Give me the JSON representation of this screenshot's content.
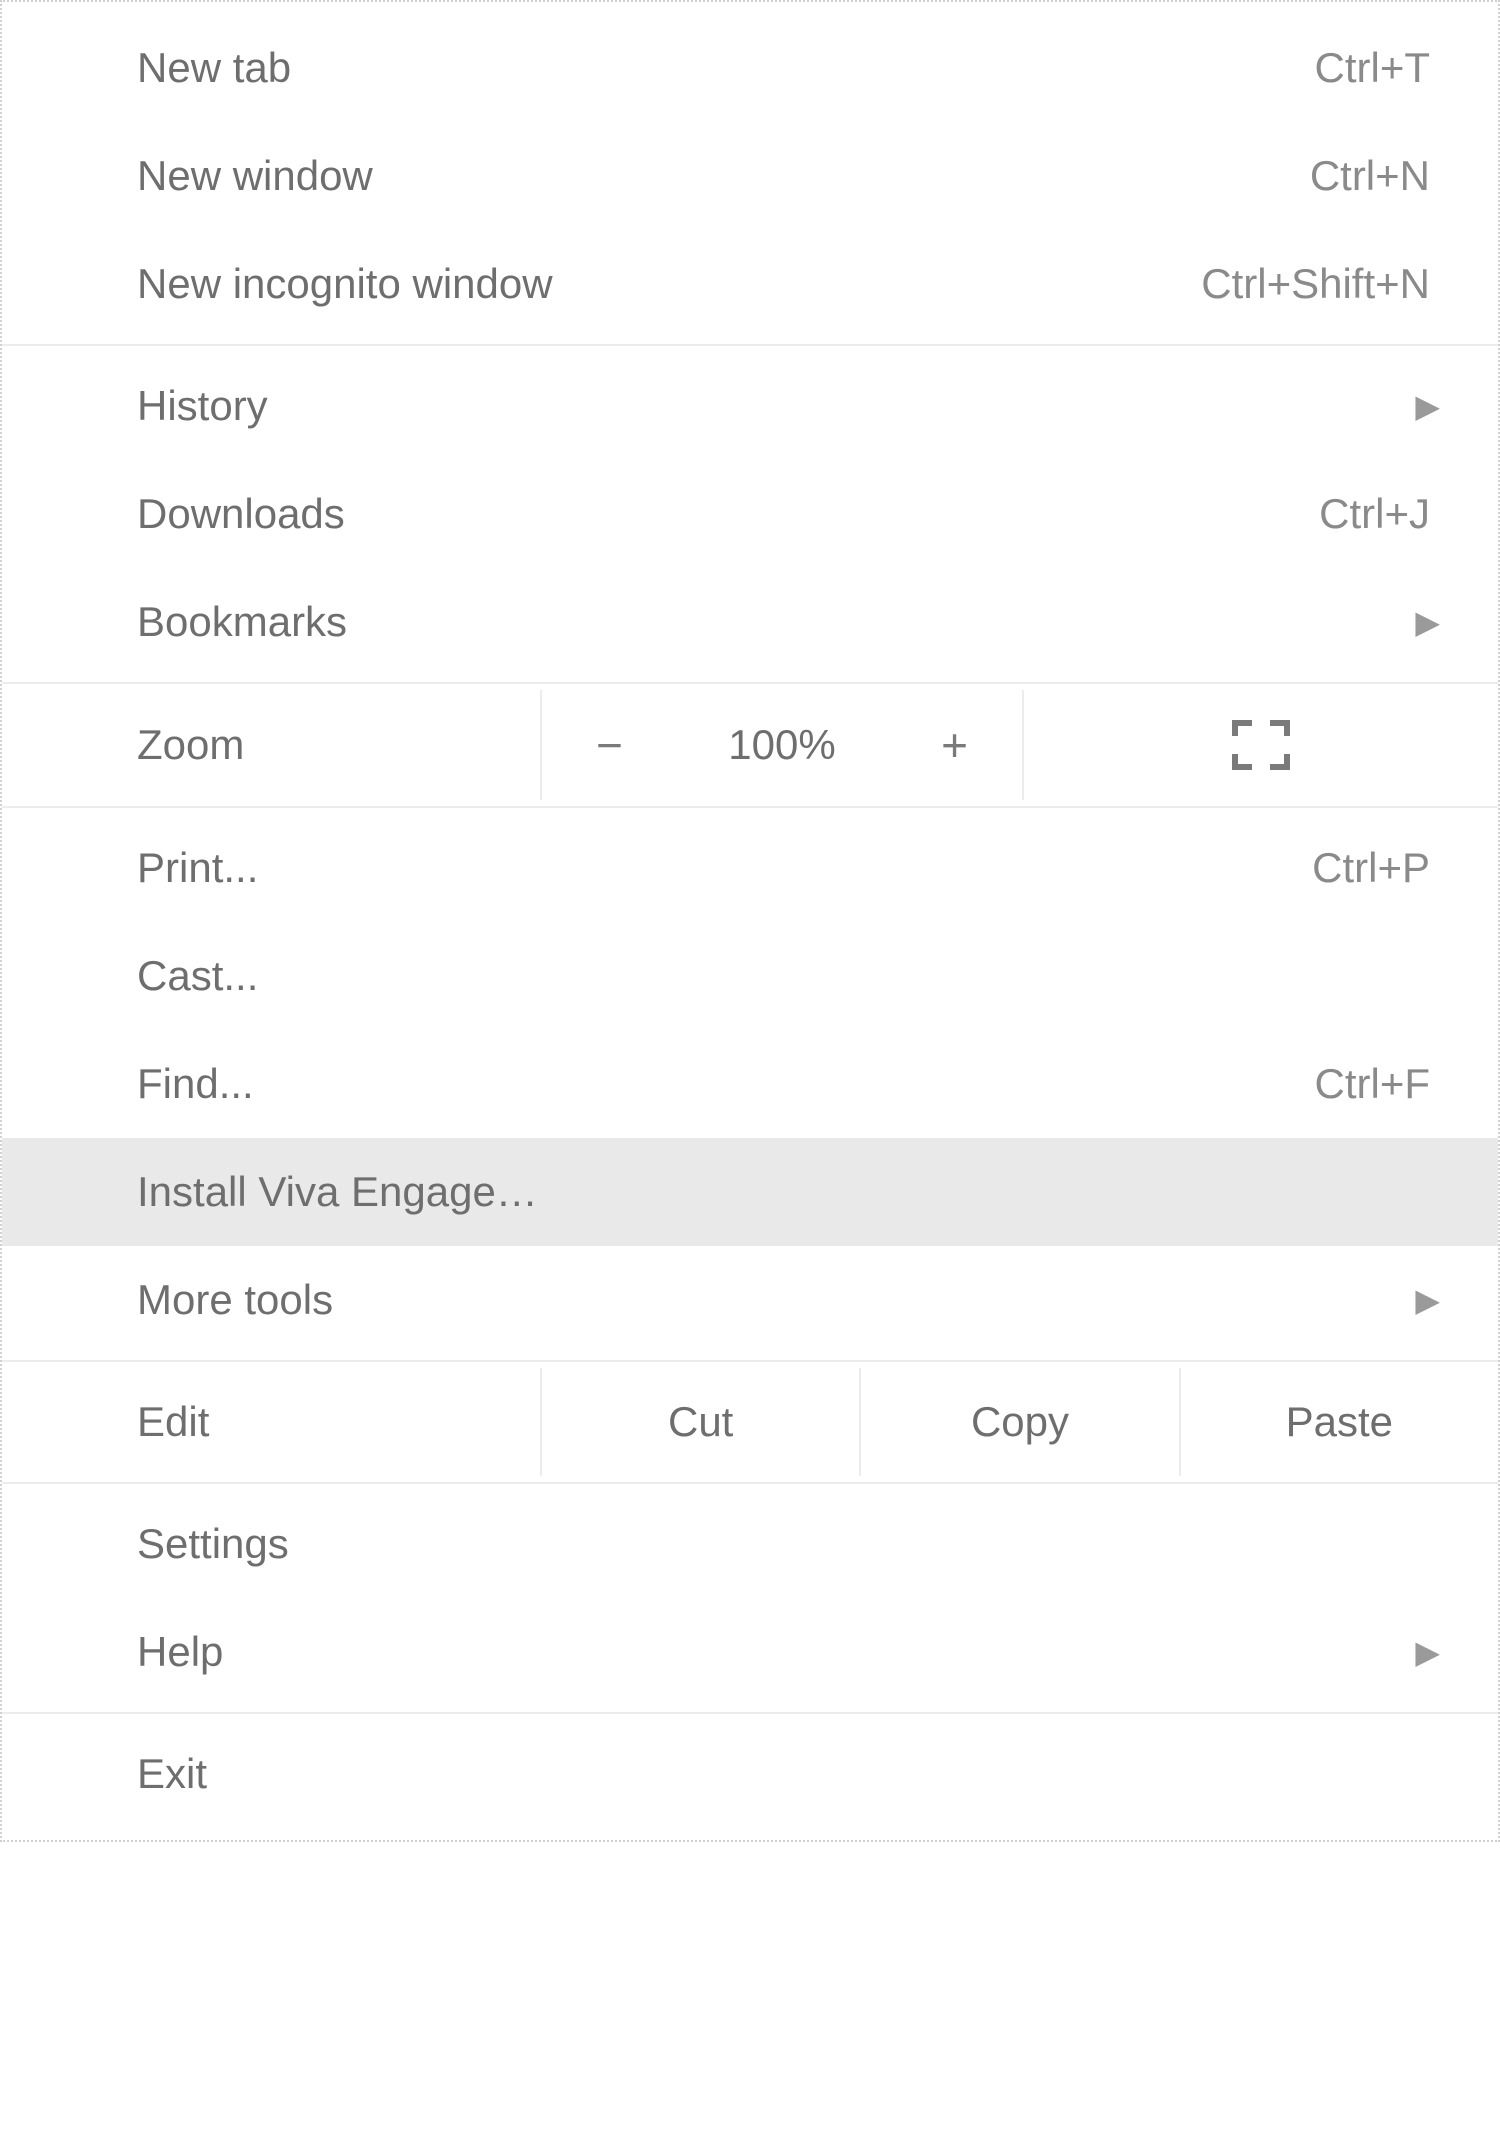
{
  "menu": {
    "section1": {
      "new_tab": {
        "label": "New tab",
        "shortcut": "Ctrl+T"
      },
      "new_window": {
        "label": "New window",
        "shortcut": "Ctrl+N"
      },
      "new_incognito": {
        "label": "New incognito window",
        "shortcut": "Ctrl+Shift+N"
      }
    },
    "section2": {
      "history": {
        "label": "History"
      },
      "downloads": {
        "label": "Downloads",
        "shortcut": "Ctrl+J"
      },
      "bookmarks": {
        "label": "Bookmarks"
      }
    },
    "zoom": {
      "label": "Zoom",
      "minus": "−",
      "value": "100%",
      "plus": "+"
    },
    "section4": {
      "print": {
        "label": "Print...",
        "shortcut": "Ctrl+P"
      },
      "cast": {
        "label": "Cast..."
      },
      "find": {
        "label": "Find...",
        "shortcut": "Ctrl+F"
      },
      "install": {
        "label": "Install Viva Engage…"
      },
      "more_tools": {
        "label": "More tools"
      }
    },
    "edit": {
      "label": "Edit",
      "cut": "Cut",
      "copy": "Copy",
      "paste": "Paste"
    },
    "section6": {
      "settings": {
        "label": "Settings"
      },
      "help": {
        "label": "Help"
      }
    },
    "section7": {
      "exit": {
        "label": "Exit"
      }
    }
  }
}
